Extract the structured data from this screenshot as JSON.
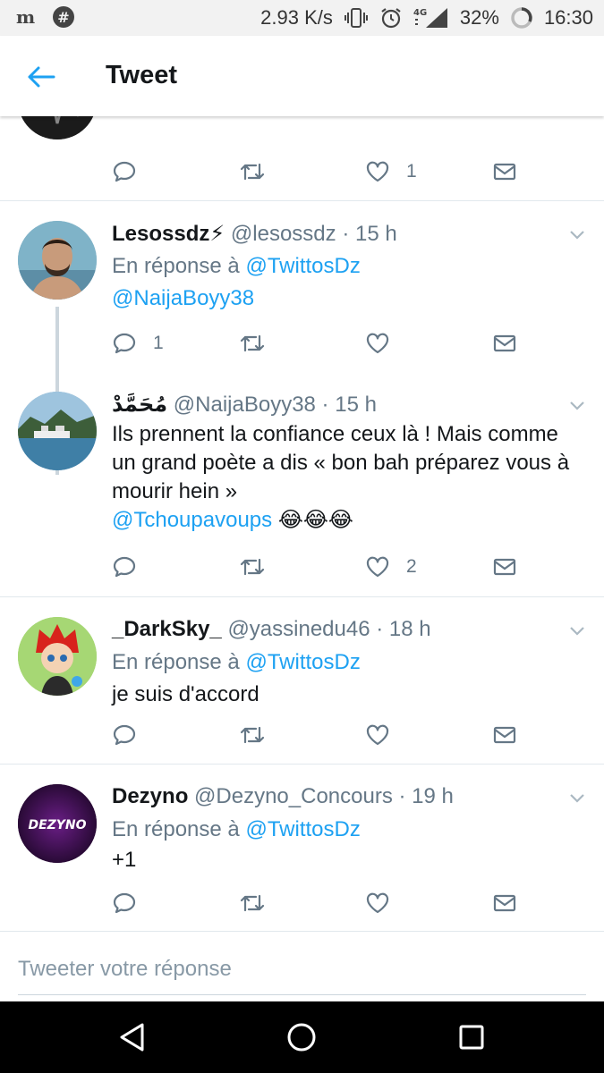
{
  "status_bar": {
    "speed": "2.93 K/s",
    "network": "4G",
    "battery": "32%",
    "time": "16:30",
    "left_icons": [
      "m-app-icon",
      "hash-app-icon"
    ],
    "right_icons": [
      "vibrate-icon",
      "alarm-icon",
      "signal-icon",
      "battery-circle-icon"
    ]
  },
  "app_bar": {
    "title": "Tweet",
    "back_icon": "arrow-left-icon"
  },
  "top_tweet_actions": {
    "likes": "1"
  },
  "tweets": [
    {
      "name": "Lesossdz⚡",
      "handle": "@lesossdz · 15 h",
      "reply_prefix": "En réponse à",
      "reply_to": [
        "@TwittosDz",
        "@NaijaBoyy38"
      ],
      "body": "",
      "replies": "1",
      "retweets": "",
      "likes": ""
    },
    {
      "name": "مُحَمَّدْ",
      "handle": "@NaijaBoyy38 · 15 h",
      "reply_prefix": "",
      "reply_to": [],
      "body": "Ils prennent la confiance ceux là ! Mais comme un grand poète a dis « bon bah préparez vous à mourir hein »",
      "body_mention": "@Tchoupavoups",
      "body_emoji": "😂😂😂",
      "replies": "",
      "retweets": "",
      "likes": "2"
    },
    {
      "name": "_DarkSky_",
      "handle": "@yassinedu46 · 18 h",
      "reply_prefix": "En réponse à",
      "reply_to": [
        "@TwittosDz"
      ],
      "body": "je suis d'accord",
      "replies": "",
      "retweets": "",
      "likes": ""
    },
    {
      "name": "Dezyno",
      "handle": "@Dezyno_Concours · 19 h",
      "reply_prefix": "En réponse à",
      "reply_to": [
        "@TwittosDz"
      ],
      "body": "+1",
      "avatar_text": "DEZYNO",
      "replies": "",
      "retweets": "",
      "likes": ""
    }
  ],
  "compose": {
    "placeholder": "Tweeter votre réponse"
  },
  "colors": {
    "accent": "#1da1f2",
    "muted": "#657786",
    "text": "#14171a"
  }
}
